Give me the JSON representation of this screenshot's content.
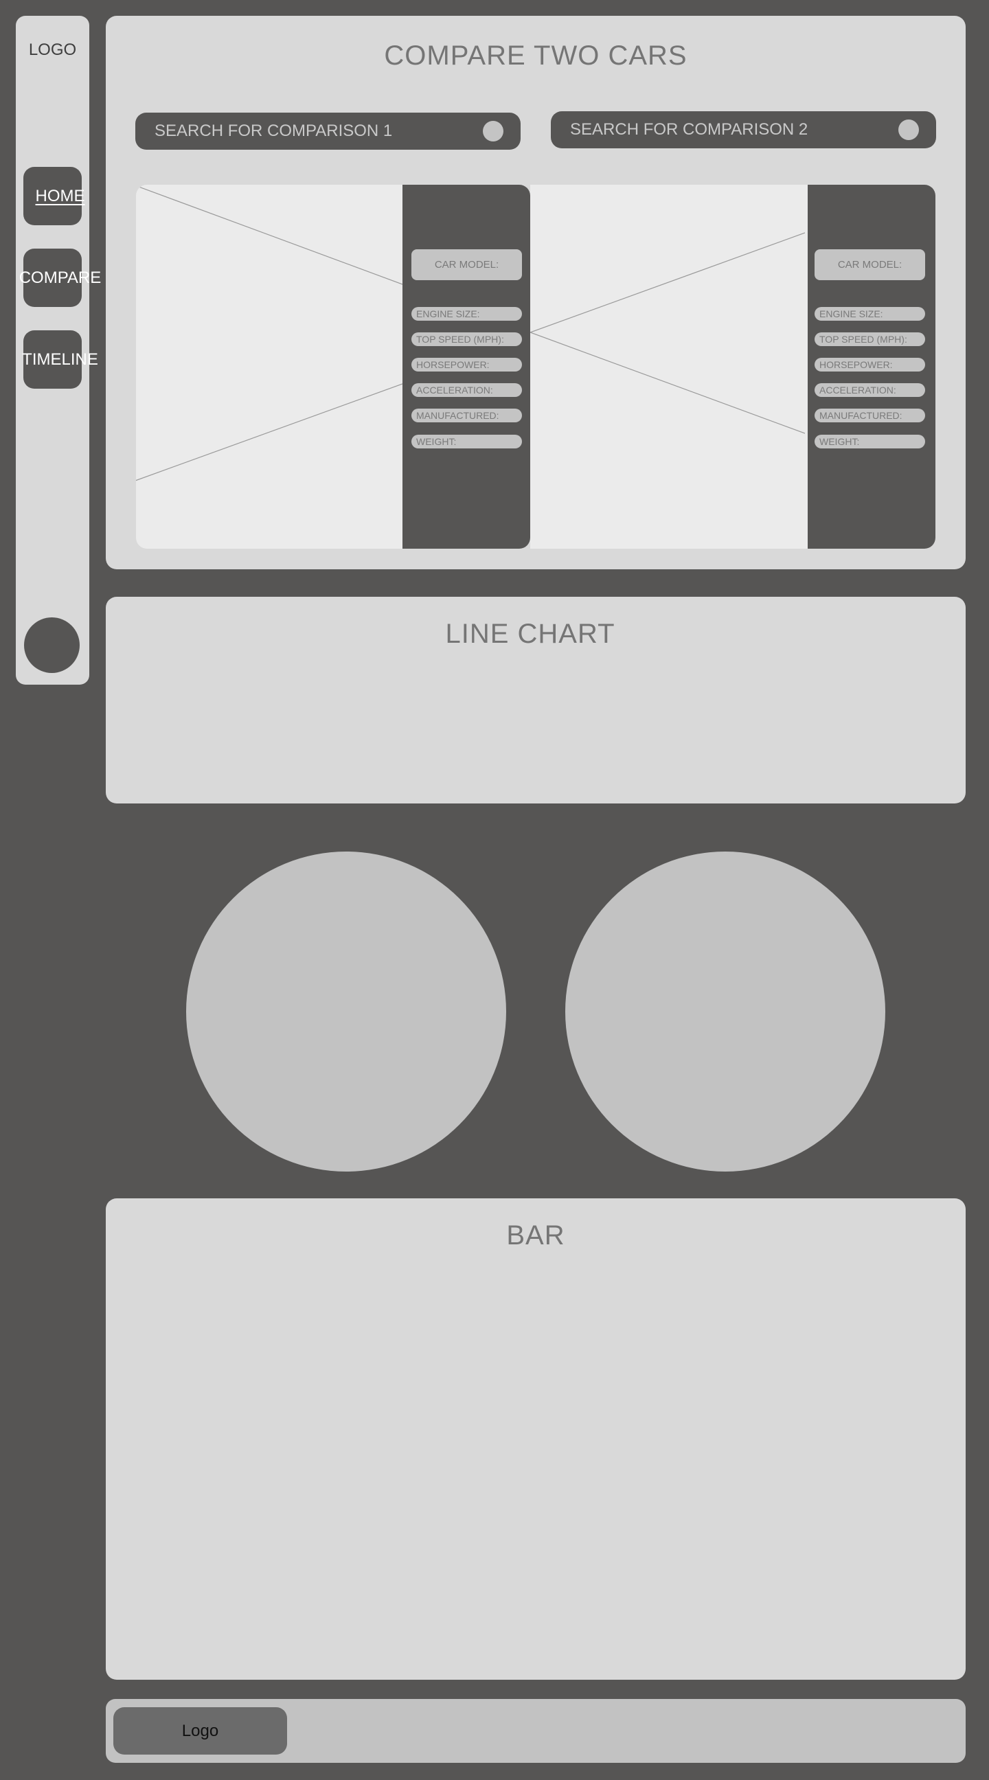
{
  "sidebar": {
    "logo": "LOGO",
    "nav": [
      {
        "label": "HOME"
      },
      {
        "label": "COMPARE"
      },
      {
        "label": "TIMELINE"
      }
    ]
  },
  "compare": {
    "title": "COMPARE TWO CARS",
    "search1_placeholder": "SEARCH FOR COMPARISON 1",
    "search2_placeholder": "SEARCH FOR COMPARISON 2",
    "car_model_label": "CAR MODEL:",
    "specs": [
      "ENGINE SIZE:",
      "TOP SPEED (MPH):",
      "HORSEPOWER:",
      "ACCELERATION:",
      "MANUFACTURED:",
      "WEIGHT:"
    ]
  },
  "line_chart": {
    "title": "LINE CHART"
  },
  "bar": {
    "title": "BAR"
  },
  "footer": {
    "logo": "Logo"
  },
  "colors": {
    "background": "#565554",
    "panel": "#d9d9d9",
    "accent_dark": "#565554",
    "pill": "#c4c4c4"
  }
}
